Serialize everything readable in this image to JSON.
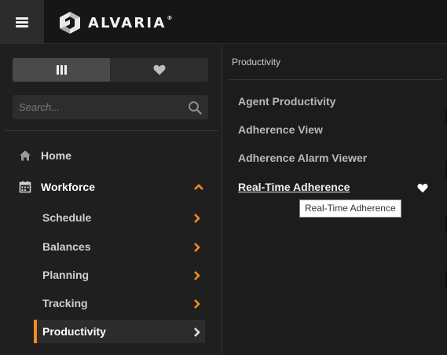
{
  "app": {
    "brand_name": "ALVARIA",
    "brand_mark": "®"
  },
  "sidebar": {
    "toggle": {
      "left_icon": "columns-icon",
      "right_icon": "heart-icon"
    },
    "search": {
      "placeholder": "Search...",
      "value": "",
      "icon": "search-icon"
    },
    "nav": [
      {
        "label": "Home",
        "icon": "home-icon"
      },
      {
        "label": "Workforce",
        "icon": "calendar-icon",
        "expanded": true
      }
    ],
    "workforce_items": [
      {
        "label": "Schedule",
        "active": false
      },
      {
        "label": "Balances",
        "active": false
      },
      {
        "label": "Planning",
        "active": false
      },
      {
        "label": "Tracking",
        "active": false
      },
      {
        "label": "Productivity",
        "active": true
      }
    ]
  },
  "panel": {
    "header": "Productivity",
    "items": [
      {
        "label": "Agent Productivity"
      },
      {
        "label": "Adherence View"
      },
      {
        "label": "Adherence Alarm Viewer"
      },
      {
        "label": "Real-Time Adherence",
        "hovered": true
      }
    ],
    "tooltip": "Real-Time Adherence"
  },
  "colors": {
    "accent": "#f28c22",
    "background": "#1e1e1e",
    "topbar": "#161616",
    "text": "#cfcfcf"
  }
}
